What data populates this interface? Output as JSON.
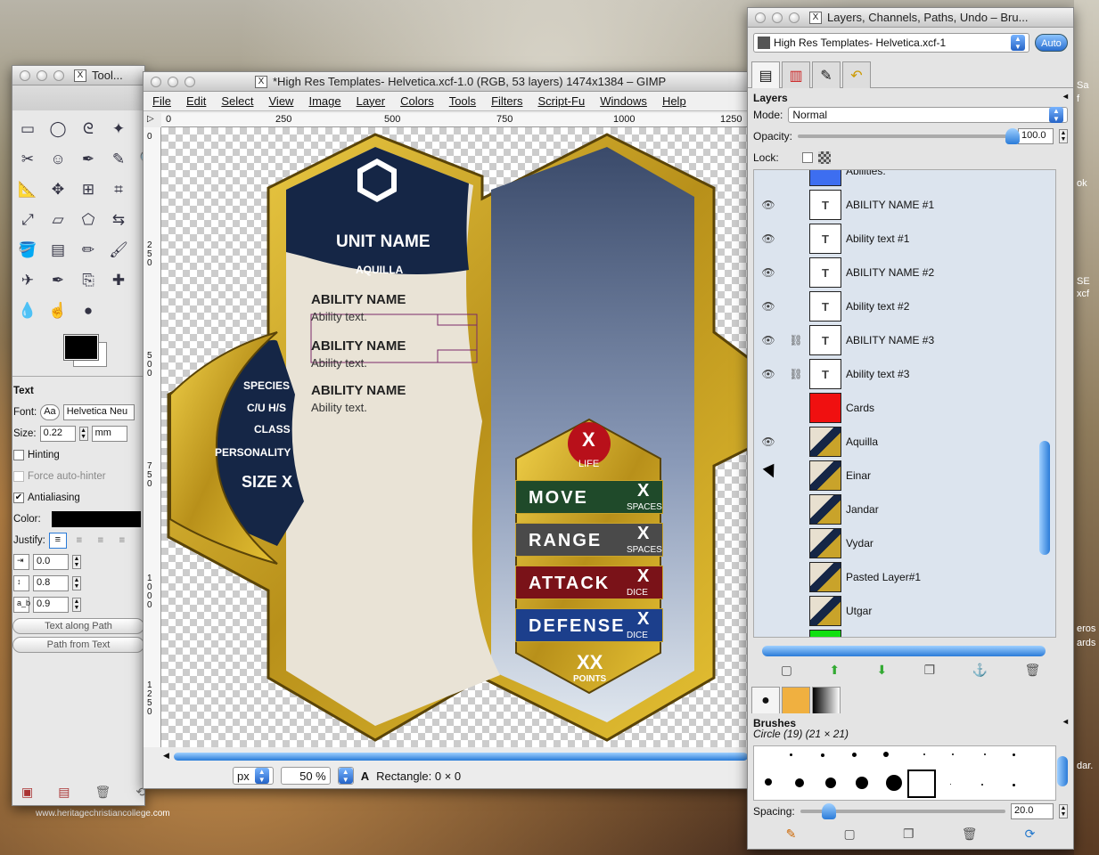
{
  "desktop": {
    "watermark": "www.heritagechristiancollege.com",
    "right_labels": [
      "Sa",
      "f",
      "ok",
      "SE",
      "xcf",
      "eros",
      "ards",
      "dar."
    ]
  },
  "toolbox": {
    "title": "Tool...",
    "tools": [
      "rect-select-icon",
      "ellipse-select-icon",
      "lasso-icon",
      "fuzzy-select-icon",
      "select-by-color-icon",
      "scissors-icon",
      "foreground-select-icon",
      "paths-icon",
      "color-picker-icon",
      "zoom-icon",
      "measure-icon",
      "move-icon",
      "align-icon",
      "crop-icon",
      "rotate-icon",
      "scale-icon",
      "shear-icon",
      "perspective-icon",
      "flip-icon",
      "text-icon",
      "bucket-fill-icon",
      "blend-icon",
      "pencil-icon",
      "paintbrush-icon",
      "eraser-icon",
      "airbrush-icon",
      "ink-icon",
      "clone-icon",
      "heal-icon",
      "perspective-clone-icon",
      "blur-icon",
      "smudge-icon",
      "dodge-icon"
    ],
    "options": {
      "section": "Text",
      "font_label": "Font:",
      "font_button": "Aa",
      "font_value": "Helvetica Neu",
      "size_label": "Size:",
      "size_value": "0.22",
      "size_unit": "mm",
      "hinting": "Hinting",
      "force_autohinter": "Force auto-hinter",
      "antialiasing": "Antialiasing",
      "color_label": "Color:",
      "justify_label": "Justify:",
      "indent": "0.0",
      "line_spacing": "0.8",
      "letter_spacing": "0.9",
      "text_along_path": "Text along Path",
      "path_from_text": "Path from Text"
    }
  },
  "image_window": {
    "title": "*High Res Templates- Helvetica.xcf-1.0 (RGB, 53 layers) 1474x1384 – GIMP",
    "menu": [
      "File",
      "Edit",
      "Select",
      "View",
      "Image",
      "Layer",
      "Colors",
      "Tools",
      "Filters",
      "Script-Fu",
      "Windows",
      "Help"
    ],
    "hruler": [
      "0",
      "250",
      "500",
      "750",
      "1000",
      "1250"
    ],
    "vruler": [
      "0",
      "250",
      "500",
      "750",
      "1000",
      "1250"
    ],
    "status": {
      "unit": "px",
      "zoom": "50 %",
      "message": "Rectangle: 0 × 0"
    }
  },
  "card": {
    "unit_name": "UNIT NAME",
    "sub_name": "AQUILLA",
    "abilities": [
      {
        "name": "ABILITY NAME",
        "text": "Ability text."
      },
      {
        "name": "ABILITY NAME",
        "text": "Ability text."
      },
      {
        "name": "ABILITY NAME",
        "text": "Ability text."
      }
    ],
    "stats_left": [
      "SPECIES",
      "C/U H/S",
      "CLASS",
      "PERSONALITY",
      "SIZE X"
    ],
    "life_value": "X",
    "life_label": "LIFE",
    "stats": [
      {
        "label": "MOVE",
        "value": "X",
        "unit": "SPACES",
        "color": "#1f4a2a"
      },
      {
        "label": "RANGE",
        "value": "X",
        "unit": "SPACES",
        "color": "#4a4a4a"
      },
      {
        "label": "ATTACK",
        "value": "X",
        "unit": "DICE",
        "color": "#7a1218"
      },
      {
        "label": "DEFENSE",
        "value": "X",
        "unit": "DICE",
        "color": "#1c3f8c"
      }
    ],
    "points_value": "XX",
    "points_label": "POINTS"
  },
  "dock": {
    "title": "Layers, Channels, Paths, Undo – Bru...",
    "image_select": "High Res Templates- Helvetica.xcf-1",
    "auto": "Auto",
    "layers_title": "Layers",
    "mode_label": "Mode:",
    "mode_value": "Normal",
    "opacity_label": "Opacity:",
    "opacity_value": "100.0",
    "opacity_fraction": 1.0,
    "lock_label": "Lock:",
    "layers": [
      {
        "name": "Abilities:",
        "thumb": "blue",
        "eye": false,
        "chain": false
      },
      {
        "name": "ABILITY NAME #1",
        "thumb": "text",
        "eye": true,
        "chain": false
      },
      {
        "name": "Ability text #1",
        "thumb": "text",
        "eye": true,
        "chain": false
      },
      {
        "name": "ABILITY NAME #2",
        "thumb": "text",
        "eye": true,
        "chain": false
      },
      {
        "name": "Ability text #2",
        "thumb": "text",
        "eye": true,
        "chain": false
      },
      {
        "name": "ABILITY NAME #3",
        "thumb": "text",
        "eye": true,
        "chain": true
      },
      {
        "name": "Ability text #3",
        "thumb": "text",
        "eye": true,
        "chain": true
      },
      {
        "name": "Cards",
        "thumb": "red",
        "eye": false,
        "chain": false
      },
      {
        "name": "Aquilla",
        "thumb": "card",
        "eye": true,
        "chain": false
      },
      {
        "name": "Einar",
        "thumb": "card",
        "eye": false,
        "chain": false
      },
      {
        "name": "Jandar",
        "thumb": "card",
        "eye": false,
        "chain": false
      },
      {
        "name": "Vydar",
        "thumb": "card",
        "eye": false,
        "chain": false
      },
      {
        "name": "Pasted Layer#1",
        "thumb": "card",
        "eye": false,
        "chain": false
      },
      {
        "name": "Utgar",
        "thumb": "card",
        "eye": false,
        "chain": false
      },
      {
        "name": "",
        "thumb": "green",
        "eye": false,
        "chain": false
      }
    ],
    "brushes_title": "Brushes",
    "brush_name": "Circle (19) (21 × 21)",
    "spacing_label": "Spacing:",
    "spacing_value": "20.0"
  }
}
